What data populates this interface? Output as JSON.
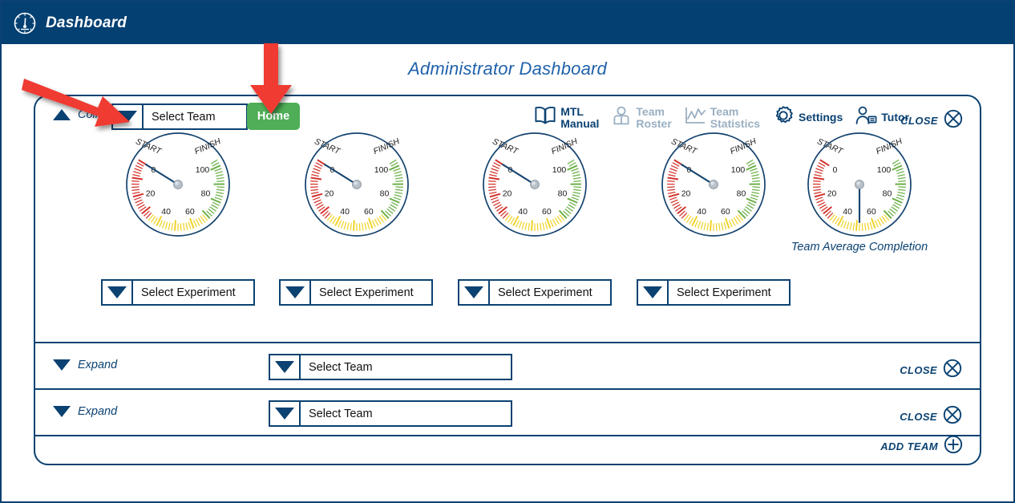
{
  "window": {
    "title": "Dashboard",
    "title_icon": "gauge-icon"
  },
  "page": {
    "title": "Administrator Dashboard"
  },
  "colors": {
    "header_navy": "#044072",
    "border_navy": "#0b4272",
    "title_blue": "#1f62ab",
    "home_green": "#4fae57",
    "muted_gray": "#9aafc2",
    "arrow_red": "#ef3b33",
    "gauge_red": "#d2332c",
    "gauge_yellow": "#f0d32a",
    "gauge_green": "#6cb049",
    "needle_navy": "#14436e"
  },
  "toolbar": {
    "items": [
      {
        "label": "MTL\nManual",
        "icon": "book-icon",
        "enabled": true
      },
      {
        "label": "Team\nRoster",
        "icon": "person-icon",
        "enabled": false
      },
      {
        "label": "Team\nStatistics",
        "icon": "line-chart-icon",
        "enabled": false
      },
      {
        "label": "Settings",
        "icon": "gear-icon",
        "enabled": true
      },
      {
        "label": "Tutor",
        "icon": "tutor-icon",
        "enabled": true
      }
    ]
  },
  "expanded_team_panel": {
    "collapse_toggle": {
      "label": "Collapse",
      "direction": "up"
    },
    "team_select": {
      "value": "Select Team",
      "placeholder": "Select Team"
    },
    "home_button": {
      "label": "Home"
    },
    "close_action": {
      "label": "CLOSE",
      "icon": "close-circle-icon"
    },
    "gauges": [
      {
        "name": "gauge-1",
        "value": 0,
        "caption": ""
      },
      {
        "name": "gauge-2",
        "value": 0,
        "caption": ""
      },
      {
        "name": "gauge-3",
        "value": 0,
        "caption": ""
      },
      {
        "name": "gauge-4",
        "value": 0,
        "caption": ""
      },
      {
        "name": "gauge-team-average",
        "value": 50,
        "caption": "Team Average Completion"
      }
    ],
    "gauge_scale": {
      "ticks": [
        "0",
        "20",
        "40",
        "60",
        "80",
        "100"
      ],
      "start_label": "START",
      "finish_label": "FINISH",
      "min": 0,
      "max": 100
    },
    "experiment_selects": [
      {
        "value": "Select Experiment"
      },
      {
        "value": "Select Experiment"
      },
      {
        "value": "Select Experiment"
      },
      {
        "value": "Select Experiment"
      }
    ]
  },
  "collapsed_team_rows": [
    {
      "toggle": {
        "label": "Expand",
        "direction": "down"
      },
      "team_select": {
        "value": "Select Team"
      },
      "close_action": {
        "label": "CLOSE",
        "icon": "close-circle-icon"
      }
    },
    {
      "toggle": {
        "label": "Expand",
        "direction": "down"
      },
      "team_select": {
        "value": "Select Team"
      },
      "close_action": {
        "label": "CLOSE",
        "icon": "close-circle-icon"
      }
    }
  ],
  "add_team": {
    "label": "ADD TEAM",
    "icon": "plus-circle-icon"
  },
  "annotations": [
    {
      "name": "arrow-to-team-dropdown",
      "direction": "down-right",
      "target": "team-select-dropdown"
    },
    {
      "name": "arrow-to-home-button",
      "direction": "down",
      "target": "home-button"
    }
  ]
}
